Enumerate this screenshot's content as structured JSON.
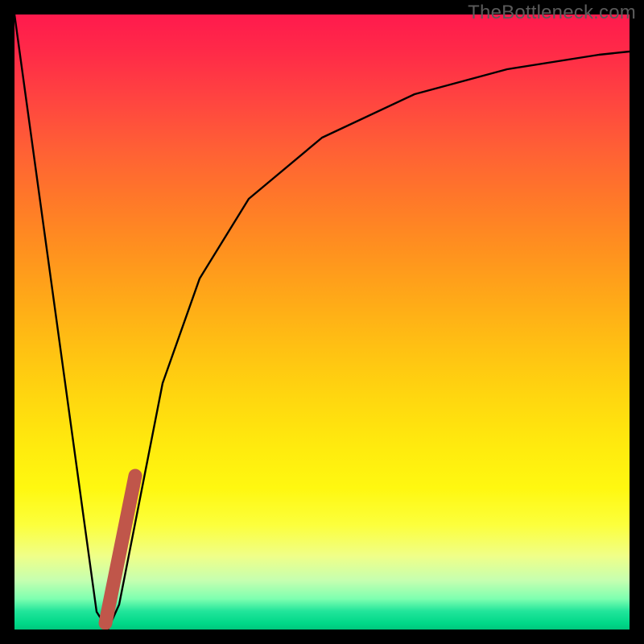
{
  "watermark": "TheBottleneck.com",
  "chart_data": {
    "type": "line",
    "title": "",
    "xlabel": "",
    "ylabel": "",
    "xlim": [
      0,
      100
    ],
    "ylim": [
      0,
      100
    ],
    "grid": false,
    "series": [
      {
        "name": "curve",
        "color": "#000000",
        "x": [
          0,
          13,
          15,
          17,
          20,
          24,
          30,
          38,
          50,
          65,
          80,
          95,
          100
        ],
        "y": [
          100,
          3,
          0,
          4,
          20,
          40,
          57,
          70,
          80,
          87,
          91,
          93.5,
          94
        ]
      },
      {
        "name": "highlight",
        "color": "#c0564a",
        "x": [
          14.5,
          19.5
        ],
        "y": [
          1,
          25
        ]
      }
    ]
  }
}
